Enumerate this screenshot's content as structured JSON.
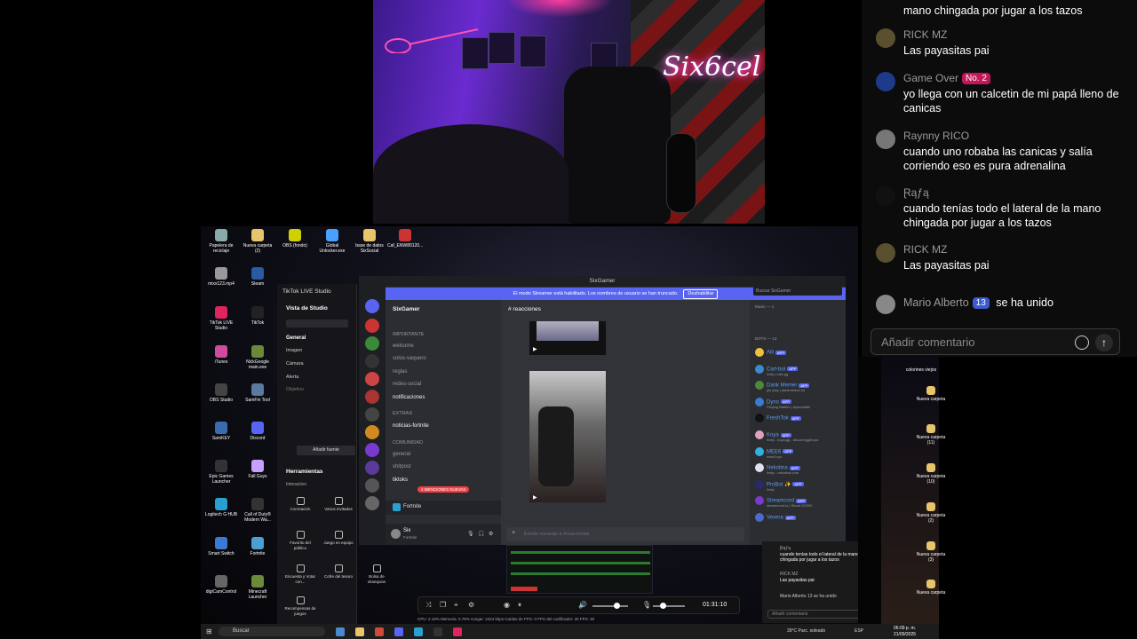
{
  "webcam": {
    "neon_sign": "Six6cel"
  },
  "chat": {
    "messages": [
      {
        "name": "",
        "text": "mano chingada por jugar a los tazos",
        "avatar_color": "#5a4a3a"
      },
      {
        "name": "RICK MZ",
        "text": "Las payasitas pai",
        "avatar_color": "#5a5030"
      },
      {
        "name": "Game Over",
        "badge": "No. 2",
        "badge_color": "#c2185b",
        "text": "yo llega con un calcetin de mi papá lleno de canicas",
        "avatar_color": "#1e3a8a"
      },
      {
        "name": "Raynny RICO",
        "text": "cuando uno robaba las canicas y salía corriendo eso es pura adrenalina",
        "avatar_color": "#777"
      },
      {
        "name": "Ɽąƒą",
        "text": "cuando tenías todo el lateral de la mano chingada por jugar a los tazos",
        "avatar_color": "#111"
      },
      {
        "name": "RICK MZ",
        "text": "Las payasitas pai",
        "avatar_color": "#5a5030"
      }
    ],
    "join": {
      "name": "Mario Alberto",
      "badge": "13",
      "text": "se ha unido"
    },
    "input_placeholder": "Añadir comentario"
  },
  "desktop": {
    "icons": [
      {
        "label": "Papelera de reciclaje",
        "color": "#8aa"
      },
      {
        "label": "Nueva carpeta (2)",
        "color": "#e8c46a"
      },
      {
        "label": "OBS (fondo)",
        "color": "#d0d000"
      },
      {
        "label": "Global Unlocker.exe",
        "color": "#4aa0ff"
      },
      {
        "label": "base de datos SixSocial",
        "color": "#e8c46a"
      },
      {
        "label": "Caf_ENW80120...",
        "color": "#c33"
      },
      {
        "label": "mixx123.mp4",
        "color": "#999"
      },
      {
        "label": "Steam",
        "color": "#2a5aa0"
      },
      {
        "label": "TikTok LIVE Studio",
        "color": "#e0245e"
      },
      {
        "label": "TikTok",
        "color": "#222"
      },
      {
        "label": "iTunes",
        "color": "#d04aa0"
      },
      {
        "label": "NickGoogle main.exe",
        "color": "#6a8a3a"
      },
      {
        "label": "OBS Studio",
        "color": "#444"
      },
      {
        "label": "SamFin Tool",
        "color": "#5a7aa0"
      },
      {
        "label": "SamKEY",
        "color": "#3a6ab0"
      },
      {
        "label": "Discord",
        "color": "#5865f2"
      },
      {
        "label": "Epic Games Launcher",
        "color": "#333"
      },
      {
        "label": "Fall Guys",
        "color": "#c7a0ff"
      },
      {
        "label": "Logitech G HUB",
        "color": "#29a0d0"
      },
      {
        "label": "Call of Duty® Modern Wa...",
        "color": "#333"
      },
      {
        "label": "Smart Switch",
        "color": "#3a7ad0"
      },
      {
        "label": "Fortnite",
        "color": "#4aa0d0"
      },
      {
        "label": "digiCamControl",
        "color": "#666"
      },
      {
        "label": "Minecraft Launcher",
        "color": "#6a8a3a"
      }
    ]
  },
  "tiktok": {
    "title": "TikTok LIVE Studio",
    "studio_view": "Vista de Studio",
    "general": "General",
    "items": [
      "Imagen",
      "Cámara",
      "Alerta",
      "Objetivo"
    ],
    "add_source": "Añadir fuente",
    "tools_header": "Herramientas",
    "interactive": "Interactivo",
    "tiles": [
      "Cocreación",
      "Varios invitados",
      "Favorito del público",
      "Juego en equipo",
      "Encuesta y Votar con...",
      "Cofre del tesoro",
      "Bolsa de obsequios",
      "Recompensas de juegos"
    ]
  },
  "discord": {
    "window_title": "SixGamer",
    "banner": "El modo Streamer está habilitado. Los nombres de usuario se han truncado.",
    "banner_button": "Deshabilitar",
    "server_name": "SixGamer",
    "current_channel": "reacciones",
    "search_placeholder": "Buscar SixGamer",
    "categories": [
      "IMPORTANTE",
      "EXTRAS",
      "COMUNIDAD"
    ],
    "channels": [
      "welcome",
      "solos-vaquero",
      "reglas",
      "redes-social",
      "notificaciones",
      "noticias-fortnite",
      "general",
      "shitpost",
      "tiktoks",
      "reacciones"
    ],
    "new_mentions": "4 MENCIONES NUEVAS",
    "voice_game": "Fortnite",
    "user_name": "Six",
    "user_status": "Fortnite",
    "message_placeholder": "Enviar mensaje a #reacciones",
    "members_header_1": "Music — 1",
    "members_header_2": "BOTS — 14",
    "members": [
      {
        "name": "Alli",
        "color": "#f0c040"
      },
      {
        "name": "Carl-bot",
        "color": "#3a8ad0",
        "sub": "/help | carl.gg"
      },
      {
        "name": "Dank Memer",
        "color": "#4a8a3a",
        "sub": "pls play | dankmemer.lol"
      },
      {
        "name": "Dyno",
        "color": "#3a7ad0",
        "sub": "Playing Battles | dyno/battle"
      },
      {
        "name": "FreshTok",
        "color": "#111"
      },
      {
        "name": "Koya",
        "color": "#e0a0c0",
        "sub": "/help - koya.gg - discord.gg/koya"
      },
      {
        "name": "MEE6",
        "color": "#30b0e0",
        "sub": "mee6.xyz"
      },
      {
        "name": "Nekotina",
        "color": "#e0e0f0",
        "sub": "/help - nekotina.com"
      },
      {
        "name": "ProBot ✨",
        "color": "#2a2a6a",
        "sub": "/help"
      },
      {
        "name": "Streamcord",
        "color": "#7a3ad0",
        "sub": "streamcord.io | Shard 32/300"
      },
      {
        "name": "Vexera",
        "color": "#4a6ad0"
      }
    ]
  },
  "overlay_chat_small": {
    "lines": [
      "Ɽąƒą",
      "cuando tenías todo el lateral de la mano chingada por jugar a los tazos",
      "RICK MZ",
      "Las payasitas pai",
      "Mario Alberto 13 se ha unido"
    ],
    "placeholder": "Añadir comentario"
  },
  "obs": {
    "time": "01:31:10",
    "stats": "CPU: 2.19%    Memoria: 0.79%    Cargar: 2424 kbps    Caídas de FPS: 0    FPS del codificador: 30    FPS: 30"
  },
  "taskbar": {
    "search": "Buscar",
    "weather": "39°C  Parc. soleado",
    "lang": "ESP",
    "time": "06:09 p. m.",
    "date": "21/09/2025"
  },
  "right_desktop": {
    "folders": [
      "colorines viejos",
      "Nueva carpeta",
      "Nueva carpeta (11)",
      "Nueva carpeta (10)",
      "Nueva carpeta (2)",
      "Nueva carpeta (3)",
      "Nueva carpeta"
    ]
  }
}
